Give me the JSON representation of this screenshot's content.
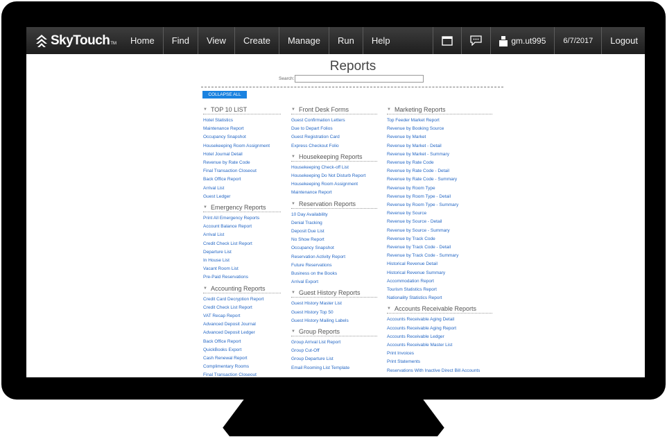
{
  "brand": {
    "name": "SkyTouch",
    "tm": "TM"
  },
  "nav": [
    "Home",
    "Find",
    "View",
    "Create",
    "Manage",
    "Run",
    "Help"
  ],
  "toolbar": {
    "user": "gm.ut995",
    "date": "6/7/2017",
    "logout": "Logout"
  },
  "page": {
    "title": "Reports",
    "search_label": "Search:",
    "search_value": "",
    "collapse_label": "COLLAPSE ALL"
  },
  "columns": [
    {
      "groups": [
        {
          "title": "TOP 10 LIST",
          "items": [
            "Hotel Statistics",
            "Maintenance Report",
            "Occupancy Snapshot",
            "Housekeeping Room Assignment",
            "Hotel Journal Detail",
            "Revenue by Rate Code",
            "Final Transaction Closeout",
            "Back Office Report",
            "Arrival List",
            "Guest Ledger"
          ]
        },
        {
          "title": "Emergency Reports",
          "items": [
            "Print All Emergency Reports",
            "Account Balance Report",
            "Arrival List",
            "Credit Check List Report",
            "Departure List",
            "In House List",
            "Vacant Room List",
            "Pre-Paid Reservations"
          ]
        },
        {
          "title": "Accounting Reports",
          "items": [
            "Credit Card Decryption Report",
            "Credit Check List Report",
            "VAT Recap Report",
            "Advanced Deposit Journal",
            "Advanced Deposit Ledger",
            "Back Office Report",
            "QuickBooks Export",
            "Cash Renewal Report",
            "Complimentary Rooms",
            "Final Transaction Closeout"
          ]
        }
      ]
    },
    {
      "groups": [
        {
          "title": "Front Desk Forms",
          "items": [
            "Guest Confirmation Letters",
            "Due to Depart Folios",
            "Guest Registration Card",
            "Express Checkout Folio"
          ]
        },
        {
          "title": "Housekeeping Reports",
          "items": [
            "Housekeeping Check-off List",
            "Housekeeping Do Not Disturb Report",
            "Housekeeping Room Assignment",
            "Maintenance Report"
          ]
        },
        {
          "title": "Reservation Reports",
          "items": [
            "10 Day Availability",
            "Denial Tracking",
            "Deposit Due List",
            "No Show Report",
            "Occupancy Snapshot",
            "Reservation Activity Report",
            "Future Reservations",
            "Business on the Books",
            "Arrival Export"
          ]
        },
        {
          "title": "Guest History Reports",
          "items": [
            "Guest History Master List",
            "Guest History Top 50",
            "Guest History Mailing Labels"
          ]
        },
        {
          "title": "Group Reports",
          "items": [
            "Group Arrival List Report",
            "Group Cut-Off",
            "Group Departure List",
            "Email Rooming List Template"
          ]
        }
      ]
    },
    {
      "groups": [
        {
          "title": "Marketing Reports",
          "items": [
            "Top Feeder Market Report",
            "Revenue by Booking Source",
            "Revenue by Market",
            "Revenue by Market - Detail",
            "Revenue by Market - Summary",
            "Revenue by Rate Code",
            "Revenue by Rate Code - Detail",
            "Revenue by Rate Code - Summary",
            "Revenue by Room Type",
            "Revenue by Room Type - Detail",
            "Revenue by Room Type - Summary",
            "Revenue by Source",
            "Revenue by Source - Detail",
            "Revenue by Source - Summary",
            "Revenue by Track Code",
            "Revenue by Track Code - Detail",
            "Revenue by Track Code - Summary",
            "Historical Revenue Detail",
            "Historical Revenue Summary",
            "Accommodation Report",
            "Tourism Statistics Report",
            "Nationality Statistics Report"
          ]
        },
        {
          "title": "Accounts Receivable Reports",
          "items": [
            "Accounts Receivable Aging Detail",
            "Accounts Receivable Aging Report",
            "Accounts Receivable Ledger",
            "Accounts Receivable Master List",
            "Print Invoices",
            "Print Statements",
            "Reservations With Inactive Direct Bill Accounts"
          ]
        }
      ]
    }
  ]
}
